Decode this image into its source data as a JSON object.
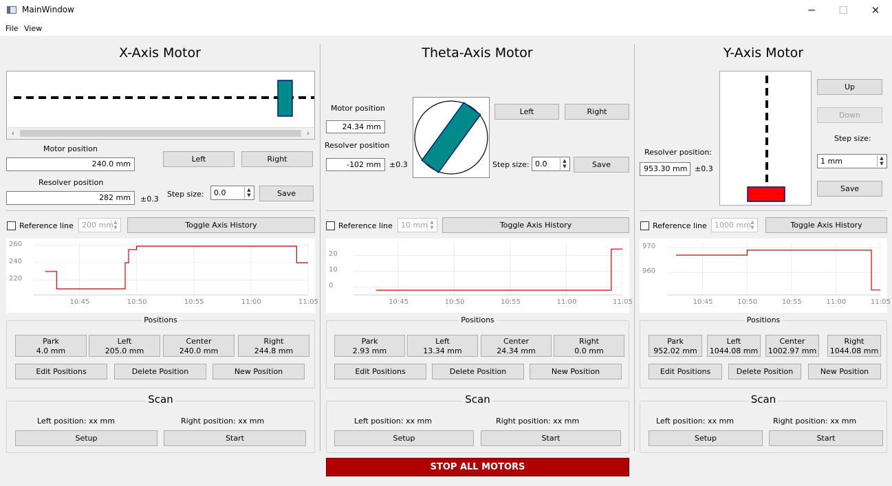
{
  "window": {
    "title": "MainWindow",
    "minimize": "─",
    "maximize": "☐",
    "close": "✕"
  },
  "menu": [
    "File",
    "View"
  ],
  "x": {
    "title": "X-Axis Motor",
    "motor_label": "Motor position",
    "motor_value": "240.0 mm",
    "resolver_label": "Resolver position",
    "resolver_value": "282 mm",
    "tol": "±0.3",
    "left": "Left",
    "right": "Right",
    "step_label": "Step size:",
    "step": "0.0",
    "save": "Save",
    "ref": "Reference line",
    "ref_value": "200 mm",
    "toggle": "Toggle Axis History",
    "positions_title": "Positions",
    "positions": [
      {
        "name": "Park",
        "val": "4.0 mm"
      },
      {
        "name": "Left",
        "val": "205.0 mm"
      },
      {
        "name": "Center",
        "val": "240.0 mm"
      },
      {
        "name": "Right",
        "val": "244.8 mm"
      }
    ],
    "edit": "Edit Positions",
    "delete": "Delete Position",
    "new": "New Position",
    "scan_title": "Scan",
    "scan_left": "Left position:  xx mm",
    "scan_right": "Right position:  xx mm",
    "setup": "Setup",
    "start": "Start",
    "scroll_left": "‹",
    "scroll_right": "›"
  },
  "theta": {
    "title": "Theta-Axis Motor",
    "motor_label": "Motor position",
    "motor_value": "24.34 mm",
    "resolver_label": "Resolver position",
    "resolver_value": "-102 mm",
    "tol": "±0.3",
    "left": "Left",
    "right": "Right",
    "step_label": "Step size:",
    "step": "0.0",
    "save": "Save",
    "ref": "Reference line",
    "ref_value": "10 mm",
    "toggle": "Toggle Axis History",
    "positions_title": "Positions",
    "positions": [
      {
        "name": "Park",
        "val": "2.93 mm"
      },
      {
        "name": "Left",
        "val": "13.34 mm"
      },
      {
        "name": "Center",
        "val": "24.34 mm"
      },
      {
        "name": "Right",
        "val": "0.0 mm"
      }
    ],
    "edit": "Edit Positions",
    "delete": "Delete Position",
    "new": "New Position",
    "scan_title": "Scan",
    "scan_left": "Left position:  xx mm",
    "scan_right": "Right position:  xx mm",
    "setup": "Setup",
    "start": "Start"
  },
  "y": {
    "title": "Y-Axis Motor",
    "up": "Up",
    "down": "Down",
    "step_label": "Step size:",
    "step": "1 mm",
    "save": "Save",
    "resolver_label": "Resolver position:",
    "resolver_value": "953.30 mm",
    "tol": "±0.3",
    "ref": "Reference line",
    "ref_value": "1000 mm",
    "toggle": "Toggle Axis History",
    "positions_title": "Positions",
    "positions": [
      {
        "name": "Park",
        "val": "952.02 mm"
      },
      {
        "name": "Left",
        "val": "1044.08 mm"
      },
      {
        "name": "Center",
        "val": "1002.97 mm"
      },
      {
        "name": "Right",
        "val": "1044.08 mm"
      }
    ],
    "edit": "Edit Positions",
    "delete": "Delete Position",
    "new": "New Position",
    "scan_title": "Scan",
    "scan_left": "Left position:  xx mm",
    "scan_right": "Right position:  xx mm",
    "setup": "Setup",
    "start": "Start"
  },
  "stop": "STOP ALL MOTORS",
  "colors": {
    "trace": "#e00000",
    "teal": "#008b8b",
    "stop": "#b00000",
    "carriage": "#ff0000"
  },
  "chart_data": [
    {
      "type": "line",
      "x_ticks": [
        "10:45",
        "10:50",
        "10:55",
        "11:00",
        "11:05"
      ],
      "y_ticks": [
        "260",
        "240",
        "220"
      ],
      "ylim": [
        203,
        263
      ],
      "xlim": [
        "10:41",
        "11:05"
      ],
      "series": [
        {
          "x": [
            "10:42",
            "10:43",
            "10:43",
            "10:49",
            "10:49",
            "10:49.3",
            "10:49.3",
            "10:50",
            "10:50",
            "11:04",
            "11:04",
            "11:05"
          ],
          "y": [
            230,
            230,
            210,
            210,
            240,
            240,
            255,
            255,
            259,
            259,
            240,
            240
          ]
        }
      ]
    },
    {
      "type": "line",
      "x_ticks": [
        "10:45",
        "10:50",
        "10:55",
        "11:00",
        "11:05"
      ],
      "y_ticks": [
        "20",
        "10",
        "0"
      ],
      "ylim": [
        -5,
        28
      ],
      "xlim": [
        "10:41",
        "11:05"
      ],
      "series": [
        {
          "x": [
            "10:43",
            "11:04",
            "11:04",
            "11:05"
          ],
          "y": [
            -2,
            -2,
            24,
            24
          ]
        }
      ]
    },
    {
      "type": "line",
      "x_ticks": [
        "10:45",
        "10:50",
        "10:55",
        "11:00",
        "11:05"
      ],
      "y_ticks": [
        "970",
        "960"
      ],
      "ylim": [
        951,
        972
      ],
      "xlim": [
        "10:41",
        "11:05"
      ],
      "series": [
        {
          "x": [
            "10:42",
            "10:50",
            "10:50",
            "11:04",
            "11:04",
            "11:05"
          ],
          "y": [
            967,
            967,
            969,
            969,
            953,
            953
          ]
        }
      ]
    }
  ]
}
